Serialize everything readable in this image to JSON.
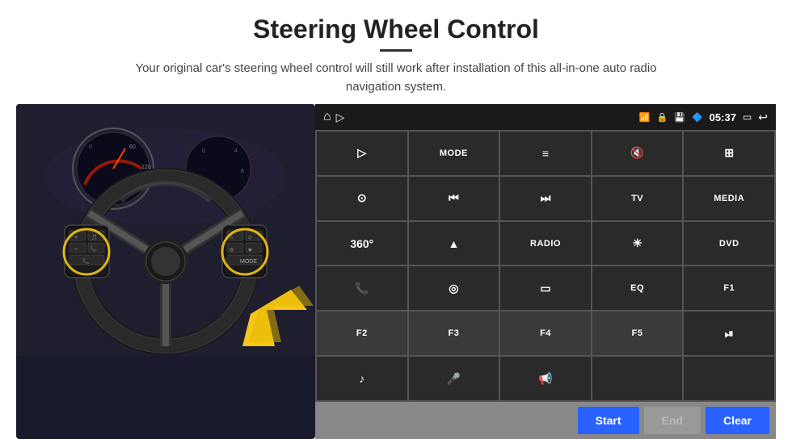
{
  "header": {
    "title": "Steering Wheel Control",
    "subtitle": "Your original car's steering wheel control will still work after installation of this all-in-one auto radio navigation system."
  },
  "statusBar": {
    "time": "05:37",
    "icons": [
      "home",
      "wifi",
      "lock",
      "bluetooth",
      "screen",
      "back"
    ]
  },
  "buttonGrid": [
    {
      "id": "r1c1",
      "type": "icon",
      "icon": "▷",
      "label": "navigate"
    },
    {
      "id": "r1c2",
      "type": "text",
      "label": "MODE"
    },
    {
      "id": "r1c3",
      "type": "icon",
      "icon": "≡",
      "label": "menu"
    },
    {
      "id": "r1c4",
      "type": "icon",
      "icon": "🔇",
      "label": "mute"
    },
    {
      "id": "r1c5",
      "type": "icon",
      "icon": "⊞",
      "label": "apps"
    },
    {
      "id": "r2c1",
      "type": "icon",
      "icon": "⊙",
      "label": "settings"
    },
    {
      "id": "r2c2",
      "type": "icon",
      "icon": "⏮",
      "label": "prev"
    },
    {
      "id": "r2c3",
      "type": "icon",
      "icon": "⏭",
      "label": "next"
    },
    {
      "id": "r2c4",
      "type": "text",
      "label": "TV"
    },
    {
      "id": "r2c5",
      "type": "text",
      "label": "MEDIA"
    },
    {
      "id": "r3c1",
      "type": "icon",
      "icon": "360°",
      "label": "360cam"
    },
    {
      "id": "r3c2",
      "type": "icon",
      "icon": "▲",
      "label": "eject"
    },
    {
      "id": "r3c3",
      "type": "text",
      "label": "RADIO"
    },
    {
      "id": "r3c4",
      "type": "icon",
      "icon": "☀",
      "label": "brightness"
    },
    {
      "id": "r3c5",
      "type": "text",
      "label": "DVD"
    },
    {
      "id": "r4c1",
      "type": "icon",
      "icon": "📞",
      "label": "phone"
    },
    {
      "id": "r4c2",
      "type": "icon",
      "icon": "◎",
      "label": "gps"
    },
    {
      "id": "r4c3",
      "type": "icon",
      "icon": "▭",
      "label": "screen-fit"
    },
    {
      "id": "r4c4",
      "type": "text",
      "label": "EQ"
    },
    {
      "id": "r4c5",
      "type": "text",
      "label": "F1"
    },
    {
      "id": "r5c1",
      "type": "text",
      "label": "F2"
    },
    {
      "id": "r5c2",
      "type": "text",
      "label": "F3"
    },
    {
      "id": "r5c3",
      "type": "text",
      "label": "F4"
    },
    {
      "id": "r5c4",
      "type": "text",
      "label": "F5"
    },
    {
      "id": "r5c5",
      "type": "icon",
      "icon": "⏯",
      "label": "play-pause"
    },
    {
      "id": "r6c1",
      "type": "icon",
      "icon": "♪",
      "label": "music"
    },
    {
      "id": "r6c2",
      "type": "icon",
      "icon": "🎤",
      "label": "mic"
    },
    {
      "id": "r6c3",
      "type": "icon",
      "icon": "📢",
      "label": "audio"
    },
    {
      "id": "r6c4",
      "type": "empty",
      "label": ""
    },
    {
      "id": "r6c5",
      "type": "empty",
      "label": ""
    }
  ],
  "actionBar": {
    "startLabel": "Start",
    "endLabel": "End",
    "clearLabel": "Clear"
  },
  "colors": {
    "accent": "#2962ff",
    "panelBg": "#2a2a2a",
    "statusBg": "#1a1a1a",
    "gridGap": "#555",
    "actionBarBg": "#888",
    "endBtnBg": "#999"
  }
}
